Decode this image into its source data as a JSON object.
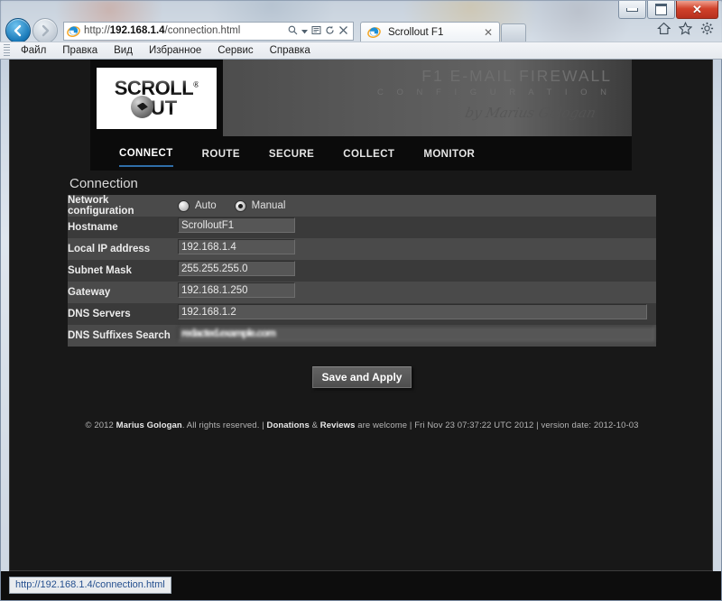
{
  "window": {
    "controls": {
      "minimize": "Minimize",
      "maximize": "Maximize",
      "close": "Close"
    }
  },
  "browser": {
    "back_label": "←",
    "forward_label": "→",
    "address": {
      "prefix": "http://",
      "host": "192.168.1.4",
      "path": "/connection.html",
      "full": "http://192.168.1.4/connection.html"
    },
    "address_icons": {
      "search": "search-dropdown",
      "compat": "compatibility-view",
      "refresh": "⟳",
      "stop": "✕"
    },
    "tab": {
      "title": "Scrollout F1",
      "close": "✕"
    },
    "tools": {
      "home": "⌂",
      "favorites": "☆",
      "settings": "⚙"
    },
    "menu": [
      "Файл",
      "Правка",
      "Вид",
      "Избранное",
      "Сервис",
      "Справка"
    ],
    "status_url": "http://192.168.1.4/connection.html"
  },
  "site": {
    "logo": {
      "line1": "SCROLL",
      "registered": "®",
      "line2": "UT"
    },
    "header": {
      "title": "F1 E-MAIL FIREWALL",
      "subtitle": "C O N F I G U R A T I O N",
      "signature": "by Marius Gologan"
    },
    "nav": [
      {
        "label": "CONNECT",
        "active": true
      },
      {
        "label": "ROUTE",
        "active": false
      },
      {
        "label": "SECURE",
        "active": false
      },
      {
        "label": "COLLECT",
        "active": false
      },
      {
        "label": "MONITOR",
        "active": false
      }
    ]
  },
  "form": {
    "section_title": "Connection",
    "network_configuration": {
      "label": "Network configuration",
      "options": [
        {
          "label": "Auto",
          "selected": false
        },
        {
          "label": "Manual",
          "selected": true
        }
      ]
    },
    "rows": [
      {
        "label": "Hostname",
        "value": "ScrolloutF1"
      },
      {
        "label": "Local IP address",
        "value": "192.168.1.4"
      },
      {
        "label": "Subnet Mask",
        "value": "255.255.255.0"
      },
      {
        "label": "Gateway",
        "value": "192.168.1.250"
      },
      {
        "label": "DNS Servers",
        "value": "192.168.1.2"
      },
      {
        "label": "DNS Suffixes Search",
        "value": "redacted.example.com"
      }
    ],
    "submit_label": "Save and Apply"
  },
  "footer": {
    "copyright_prefix": "© 2012 ",
    "author": "Marius Gologan",
    "rights": ". All rights reserved. | ",
    "donations": "Donations",
    "amp": " & ",
    "reviews": "Reviews",
    "welcome": " are welcome | ",
    "timestamp": "Fri Nov 23 07:37:22 UTC 2012",
    "separator": " | ",
    "version": "version date: 2012-10-03"
  },
  "colors": {
    "accent": "#2f6ea8",
    "page_bg": "#181818",
    "row_light": "#4a4a4a",
    "row_dark": "#3a3a3a"
  }
}
